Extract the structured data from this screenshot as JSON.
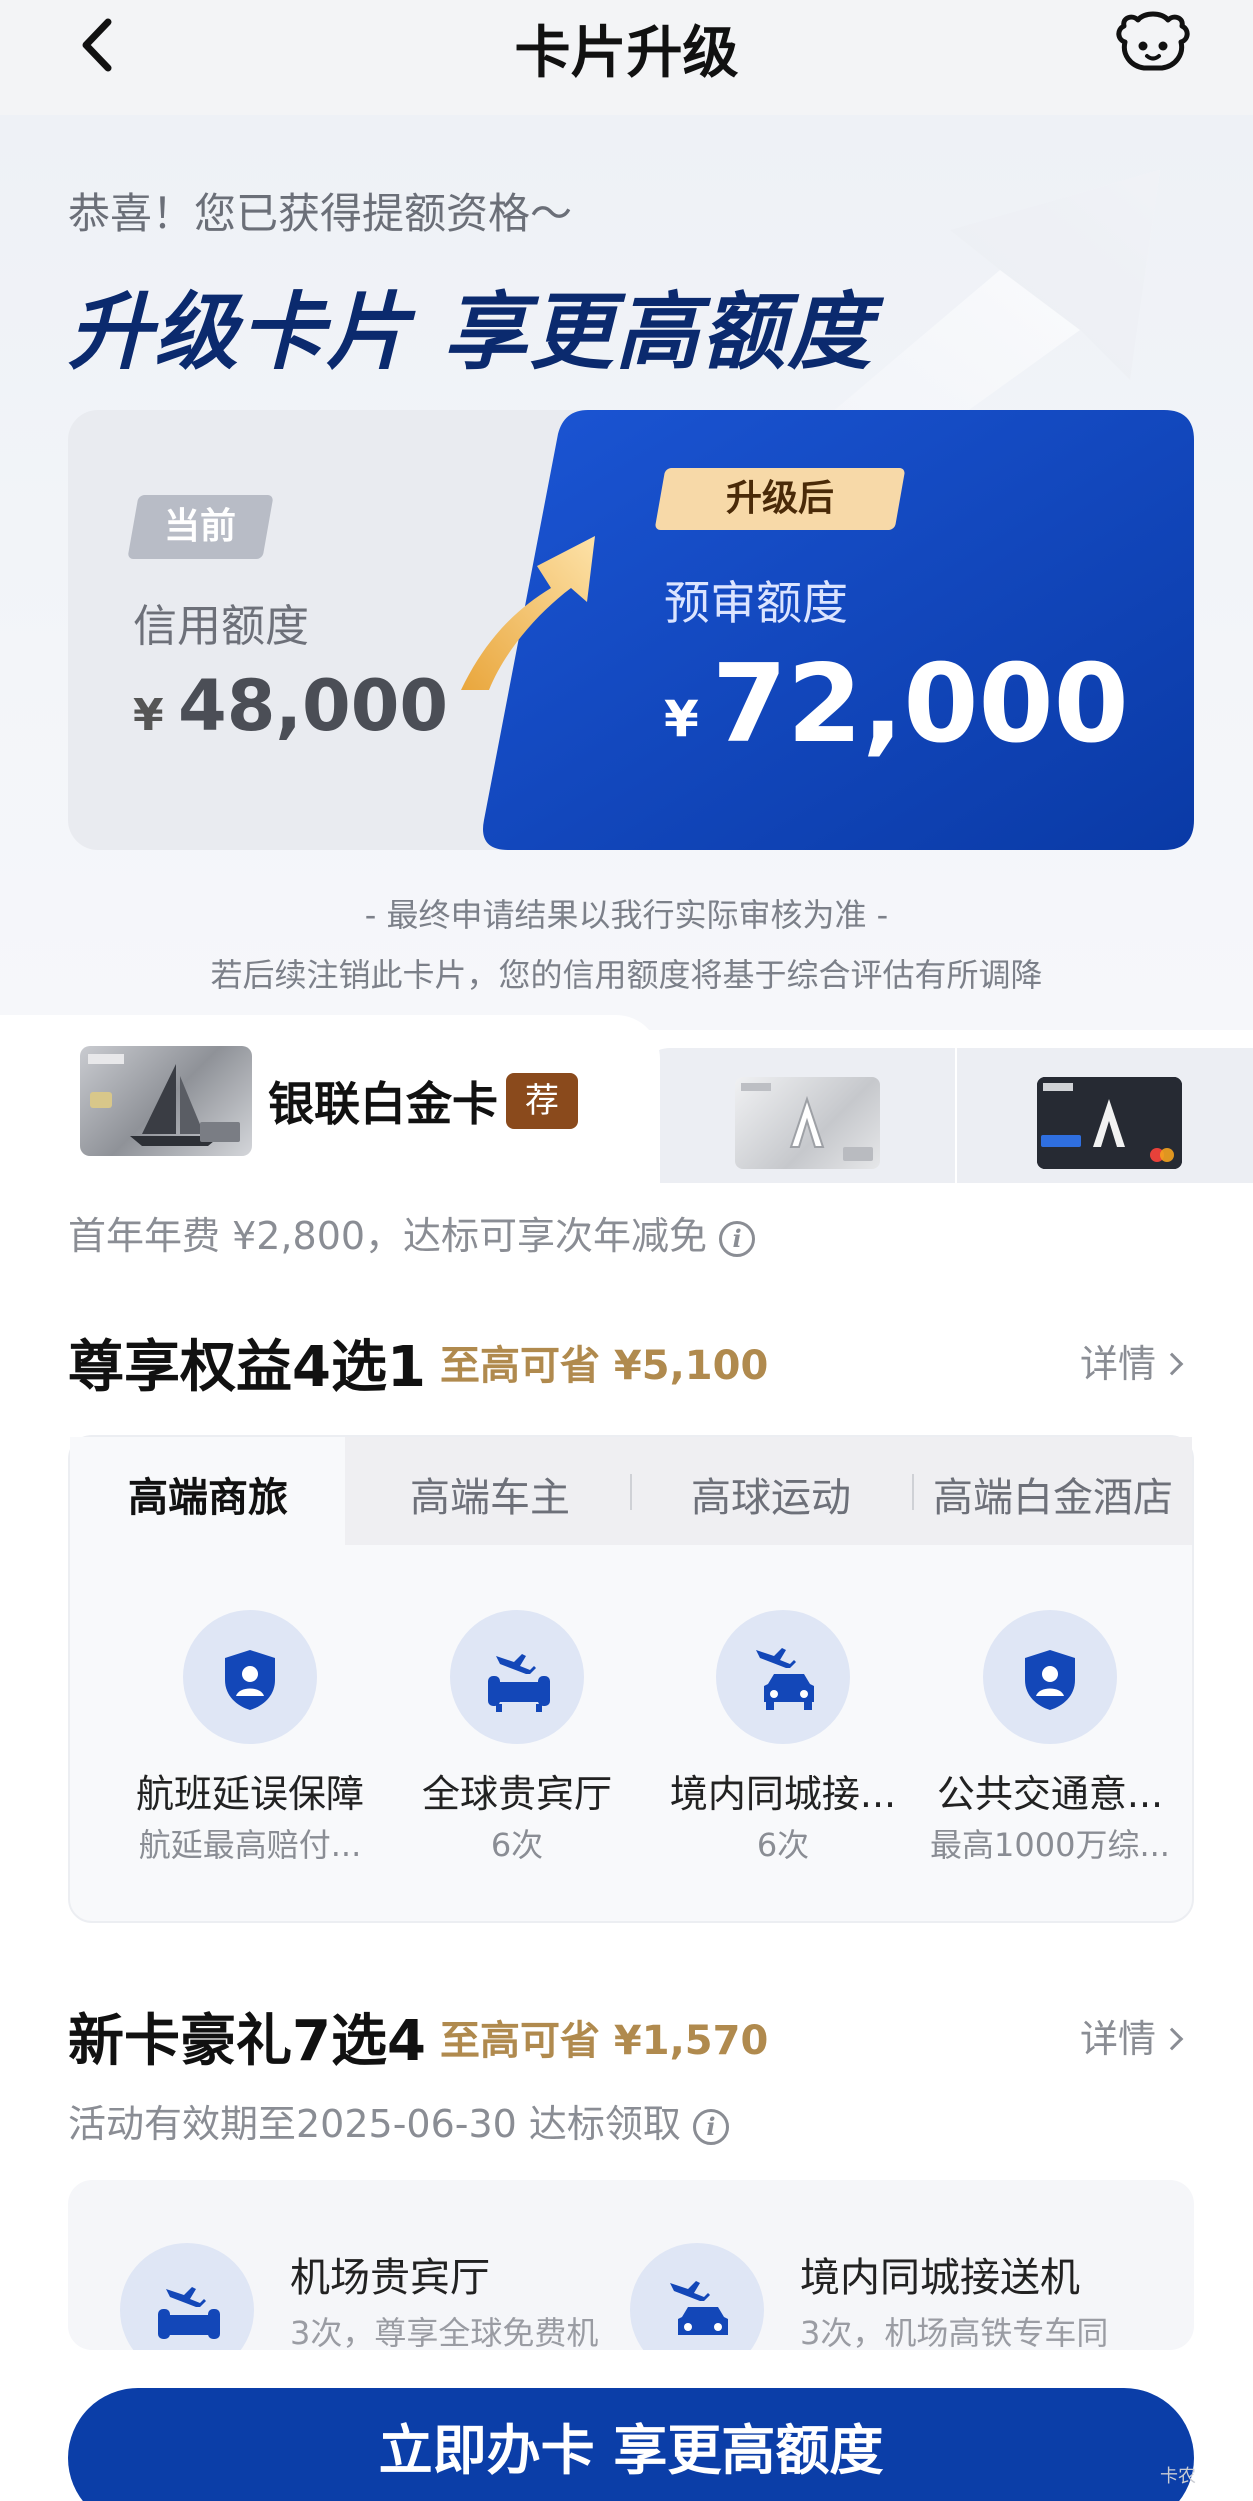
{
  "header": {
    "title": "卡片升级",
    "back_icon": "chevron-left-icon",
    "service_icon": "customer-service-robot-icon"
  },
  "hero": {
    "congrats": "恭喜！您已获得提额资格～",
    "title": "升级卡片 享更高额度",
    "current": {
      "tag": "当前",
      "label": "信用额度",
      "currency": "¥",
      "amount": "48,000"
    },
    "upgraded": {
      "tag": "升级后",
      "label": "预审额度",
      "currency": "¥",
      "amount": "72,000"
    },
    "note1": "- 最终申请结果以我行实际审核为准 -",
    "note2": "若后续注销此卡片，您的信用额度将基于综合评估有所调降",
    "colors": {
      "brand_blue": "#0b3ea8",
      "gold": "#f7d9a8"
    }
  },
  "card_select": {
    "selected_name": "银联白金卡",
    "badge": "荐",
    "fee": "首年年费 ¥2,800，达标可享次年减免"
  },
  "section1": {
    "title": "尊享权益4选1",
    "save": "至高可省 ¥5,100",
    "detail": "详情",
    "tabs": [
      "高端商旅",
      "高端车主",
      "高球运动",
      "高端白金酒店"
    ],
    "items": [
      {
        "title": "航班延误保障",
        "sub": "航延最高赔付...",
        "icon": "shield-user-icon"
      },
      {
        "title": "全球贵宾厅",
        "sub": "6次",
        "icon": "plane-sofa-icon"
      },
      {
        "title": "境内同城接...",
        "sub": "6次",
        "icon": "plane-car-icon"
      },
      {
        "title": "公共交通意...",
        "sub": "最高1000万综...",
        "icon": "shield-user-icon"
      }
    ]
  },
  "section2": {
    "title": "新卡豪礼7选4",
    "save": "至高可省 ¥1,570",
    "detail": "详情",
    "period": "活动有效期至2025-06-30  达标领取",
    "items": [
      {
        "title": "机场贵宾厅",
        "sub": "3次，尊享全球免费机",
        "icon": "plane-sofa-icon"
      },
      {
        "title": "境内同城接送机",
        "sub": "3次，机场高铁专车同",
        "icon": "plane-car-icon"
      }
    ]
  },
  "cta": {
    "label": "立即办卡 享更高额度"
  },
  "watermark": "卡农"
}
